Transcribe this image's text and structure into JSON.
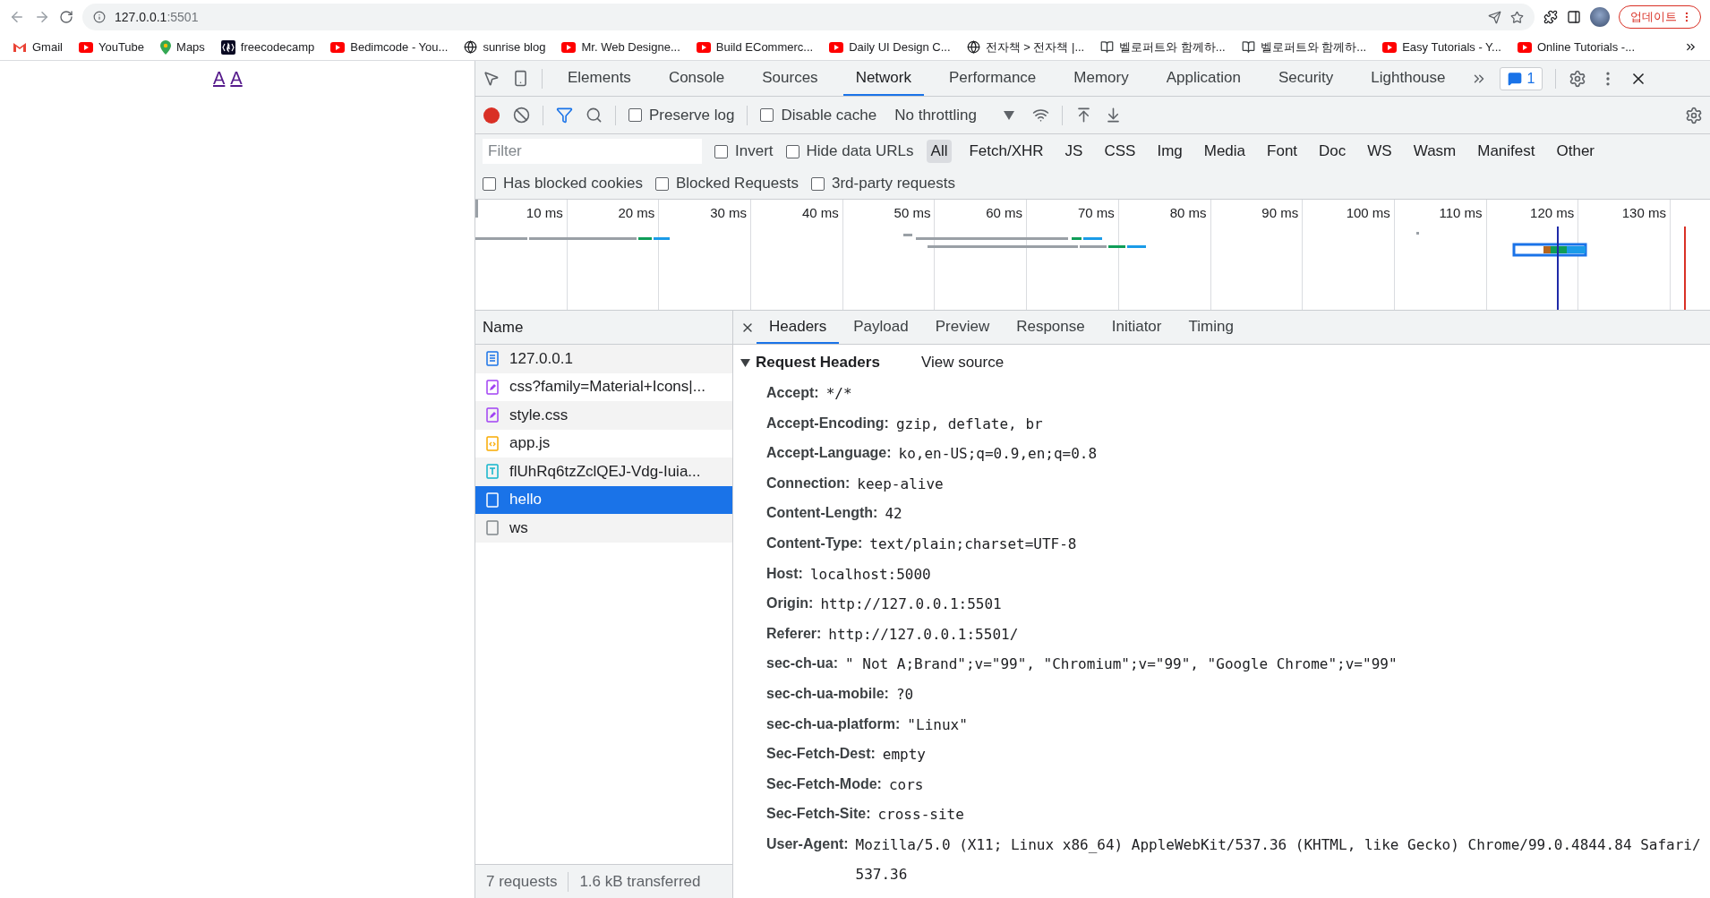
{
  "browser": {
    "address": {
      "host": "127.0.0.1",
      "port": ":5501"
    },
    "update_button": "업데이트"
  },
  "bookmarks": [
    {
      "kind": "gmail",
      "label": "Gmail"
    },
    {
      "kind": "youtube",
      "label": "YouTube"
    },
    {
      "kind": "maps",
      "label": "Maps"
    },
    {
      "kind": "fcc",
      "label": "freecodecamp"
    },
    {
      "kind": "youtube",
      "label": "Bedimcode - You..."
    },
    {
      "kind": "globe",
      "label": "sunrise blog"
    },
    {
      "kind": "youtube",
      "label": "Mr. Web Designe..."
    },
    {
      "kind": "youtube",
      "label": "Build ECommerc..."
    },
    {
      "kind": "youtube",
      "label": "Daily UI Design C..."
    },
    {
      "kind": "globe",
      "label": "전자책 > 전자책 |..."
    },
    {
      "kind": "book",
      "label": "벨로퍼트와 함께하..."
    },
    {
      "kind": "book",
      "label": "벨로퍼트와 함께하..."
    },
    {
      "kind": "youtube",
      "label": "Easy Tutorials - Y..."
    },
    {
      "kind": "youtube",
      "label": "Online Tutorials -..."
    }
  ],
  "page": {
    "links": [
      "A",
      "A"
    ]
  },
  "devtools": {
    "tabs": [
      {
        "label": "Elements",
        "selected": false
      },
      {
        "label": "Console",
        "selected": false
      },
      {
        "label": "Sources",
        "selected": false
      },
      {
        "label": "Network",
        "selected": true
      },
      {
        "label": "Performance",
        "selected": false
      },
      {
        "label": "Memory",
        "selected": false
      },
      {
        "label": "Application",
        "selected": false
      },
      {
        "label": "Security",
        "selected": false
      },
      {
        "label": "Lighthouse",
        "selected": false
      }
    ],
    "issues_count": "1",
    "recording": true,
    "filter_active": true,
    "toolbar_checks": [
      {
        "label": "Preserve log",
        "checked": false
      },
      {
        "label": "Disable cache",
        "checked": false
      }
    ],
    "throttling": "No throttling",
    "filter": {
      "placeholder": "Filter",
      "checks": [
        {
          "label": "Invert",
          "checked": false
        },
        {
          "label": "Hide data URLs",
          "checked": false
        }
      ],
      "types": [
        {
          "label": "All",
          "selected": true
        },
        {
          "label": "Fetch/XHR",
          "selected": false
        },
        {
          "label": "JS",
          "selected": false
        },
        {
          "label": "CSS",
          "selected": false
        },
        {
          "label": "Img",
          "selected": false
        },
        {
          "label": "Media",
          "selected": false
        },
        {
          "label": "Font",
          "selected": false
        },
        {
          "label": "Doc",
          "selected": false
        },
        {
          "label": "WS",
          "selected": false
        },
        {
          "label": "Wasm",
          "selected": false
        },
        {
          "label": "Manifest",
          "selected": false
        },
        {
          "label": "Other",
          "selected": false
        }
      ]
    },
    "options": [
      {
        "label": "Has blocked cookies",
        "checked": false
      },
      {
        "label": "Blocked Requests",
        "checked": false
      },
      {
        "label": "3rd-party requests",
        "checked": false
      }
    ],
    "timeline": {
      "ticks": [
        "10 ms",
        "20 ms",
        "30 ms",
        "40 ms",
        "50 ms",
        "60 ms",
        "70 ms",
        "80 ms",
        "90 ms",
        "100 ms",
        "110 ms",
        "120 ms",
        "130 ms"
      ]
    },
    "requests": {
      "header": "Name",
      "items": [
        {
          "kind": "document",
          "name": "127.0.0.1",
          "selected": false
        },
        {
          "kind": "stylesheet",
          "name": "css?family=Material+Icons|...",
          "selected": false
        },
        {
          "kind": "stylesheet",
          "name": "style.css",
          "selected": false
        },
        {
          "kind": "script",
          "name": "app.js",
          "selected": false
        },
        {
          "kind": "font",
          "name": "flUhRq6tzZclQEJ-Vdg-Iuia...",
          "selected": false
        },
        {
          "kind": "other",
          "name": "hello",
          "selected": true
        },
        {
          "kind": "other",
          "name": "ws",
          "selected": false
        }
      ],
      "summary": [
        "7 requests",
        "1.6 kB transferred"
      ]
    },
    "details": {
      "tabs": [
        {
          "label": "Headers",
          "selected": true
        },
        {
          "label": "Payload",
          "selected": false
        },
        {
          "label": "Preview",
          "selected": false
        },
        {
          "label": "Response",
          "selected": false
        },
        {
          "label": "Initiator",
          "selected": false
        },
        {
          "label": "Timing",
          "selected": false
        }
      ],
      "section": {
        "title": "Request Headers",
        "expanded": true,
        "link": "View source",
        "headers": [
          {
            "name": "Accept:",
            "value": "*/*"
          },
          {
            "name": "Accept-Encoding:",
            "value": "gzip, deflate, br"
          },
          {
            "name": "Accept-Language:",
            "value": "ko,en-US;q=0.9,en;q=0.8"
          },
          {
            "name": "Connection:",
            "value": "keep-alive"
          },
          {
            "name": "Content-Length:",
            "value": "42"
          },
          {
            "name": "Content-Type:",
            "value": "text/plain;charset=UTF-8"
          },
          {
            "name": "Host:",
            "value": "localhost:5000"
          },
          {
            "name": "Origin:",
            "value": "http://127.0.0.1:5501"
          },
          {
            "name": "Referer:",
            "value": "http://127.0.0.1:5501/"
          },
          {
            "name": "sec-ch-ua:",
            "value": "\" Not A;Brand\";v=\"99\", \"Chromium\";v=\"99\", \"Google Chrome\";v=\"99\""
          },
          {
            "name": "sec-ch-ua-mobile:",
            "value": "?0"
          },
          {
            "name": "sec-ch-ua-platform:",
            "value": "\"Linux\""
          },
          {
            "name": "Sec-Fetch-Dest:",
            "value": "empty"
          },
          {
            "name": "Sec-Fetch-Mode:",
            "value": "cors"
          },
          {
            "name": "Sec-Fetch-Site:",
            "value": "cross-site"
          },
          {
            "name": "User-Agent:",
            "value": "Mozilla/5.0 (X11; Linux x86_64) AppleWebKit/537.36 (KHTML, like Gecko) Chrome/99.0.4844.84 Safari/537.36"
          }
        ]
      }
    }
  }
}
